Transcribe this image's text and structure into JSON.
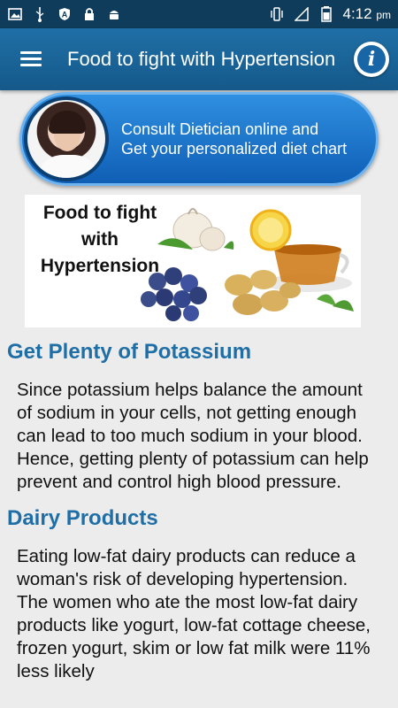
{
  "status_bar": {
    "left_icons": [
      "image-icon",
      "usb-icon",
      "shield-icon",
      "lock-icon",
      "android-icon"
    ],
    "right_icons": [
      "vibrate-icon",
      "signal-icon",
      "battery-icon"
    ],
    "time": "4:12",
    "ampm": "pm"
  },
  "app_bar": {
    "title": "Food to fight with Hypertension",
    "menu_icon": "hamburger-icon",
    "info_icon": "info-icon"
  },
  "consult_banner": {
    "line1": "Consult Dietician online and",
    "line2": "Get your personalized diet chart"
  },
  "hero_image": {
    "title_line1": "Food to fight",
    "title_line2": "with",
    "title_line3": "Hypertension"
  },
  "sections": [
    {
      "heading": "Get Plenty of Potassium",
      "body": "Since potassium helps balance the amount of sodium in your cells, not getting enough can lead to too much sodium in your blood. Hence, getting plenty of potassium can help prevent and control high blood pressure."
    },
    {
      "heading": "Dairy Products",
      "body": "Eating low-fat dairy products can reduce a woman's risk of developing hypertension. The women who ate the most low-fat dairy products like yogurt, low-fat cottage cheese, frozen yogurt, skim or low fat milk were 11% less likely"
    }
  ],
  "colors": {
    "status_bar": "#0f3c5a",
    "app_bar": "#1a64a0",
    "heading": "#1f6fa6",
    "background": "#ececec"
  }
}
